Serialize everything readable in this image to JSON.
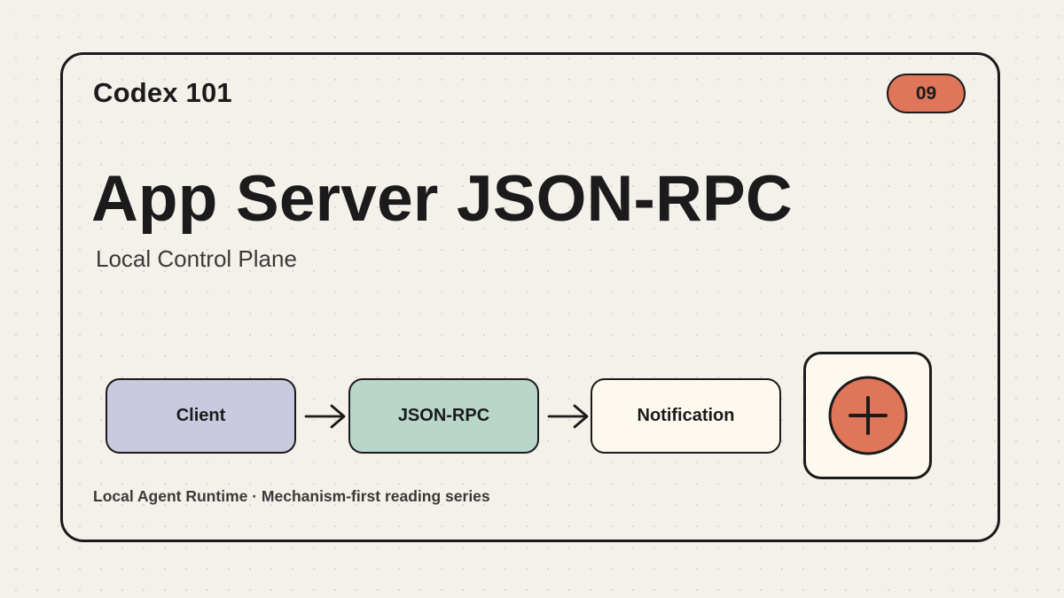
{
  "brand": "Codex 101",
  "badge": "09",
  "title": "App Server JSON-RPC",
  "subtitle": "Local Control Plane",
  "flow": {
    "nodes": [
      {
        "label": "Client",
        "color": "#c9c9df"
      },
      {
        "label": "JSON-RPC",
        "color": "#b8d6c9"
      },
      {
        "label": "Notification",
        "color": "#fdf9ee"
      }
    ]
  },
  "plus_icon": {
    "icon": "plus-circle-icon",
    "color": "#df7559"
  },
  "footer": "Local Agent Runtime · Mechanism-first reading series",
  "colors": {
    "background": "#f4f0ea",
    "ink": "#1b1b1b",
    "accent": "#df7559"
  }
}
